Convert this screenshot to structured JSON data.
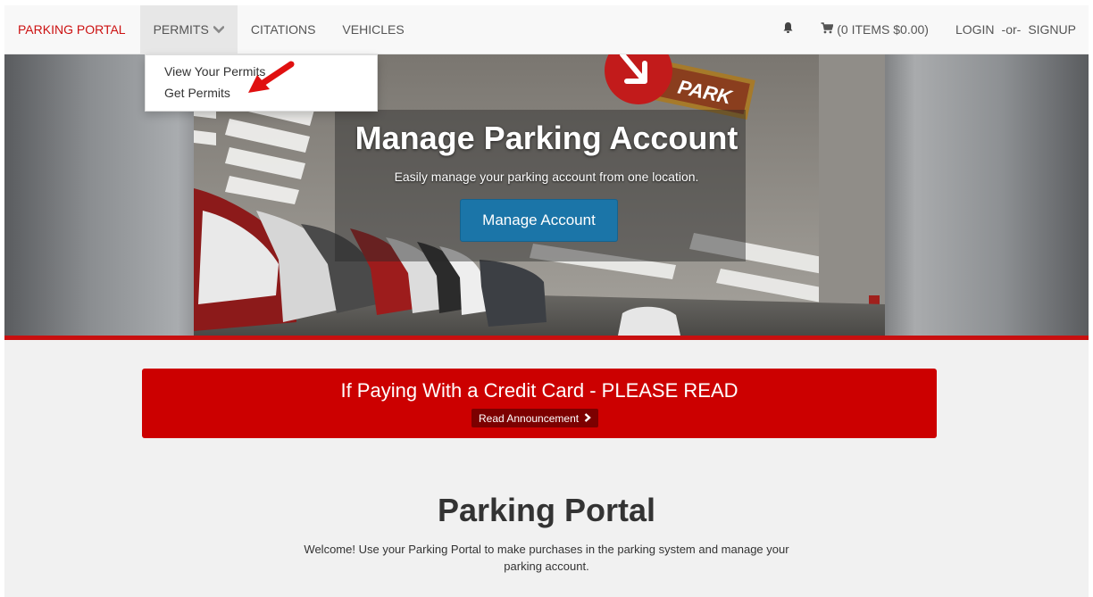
{
  "nav": {
    "brand": "PARKING PORTAL",
    "permits": "PERMITS",
    "citations": "CITATIONS",
    "vehicles": "VEHICLES",
    "cart": "(0 ITEMS $0.00)",
    "login": "LOGIN",
    "or": "-or-",
    "signup": "SIGNUP"
  },
  "dropdown": {
    "items": [
      "View Your Permits",
      "Get Permits"
    ]
  },
  "hero": {
    "title": "Manage Parking Account",
    "subtitle": "Easily manage your parking account from one location.",
    "button": "Manage Account",
    "sign_text": "PARK"
  },
  "announcement": {
    "title": "If Paying With a Credit Card - PLEASE READ",
    "button": "Read Announcement"
  },
  "intro": {
    "title": "Parking Portal",
    "text": "Welcome! Use your Parking Portal to make purchases in the parking system and manage your parking account."
  },
  "colors": {
    "brand_red": "#cc1111",
    "banner_red": "#cc0000",
    "button_blue": "#1b75a8"
  }
}
